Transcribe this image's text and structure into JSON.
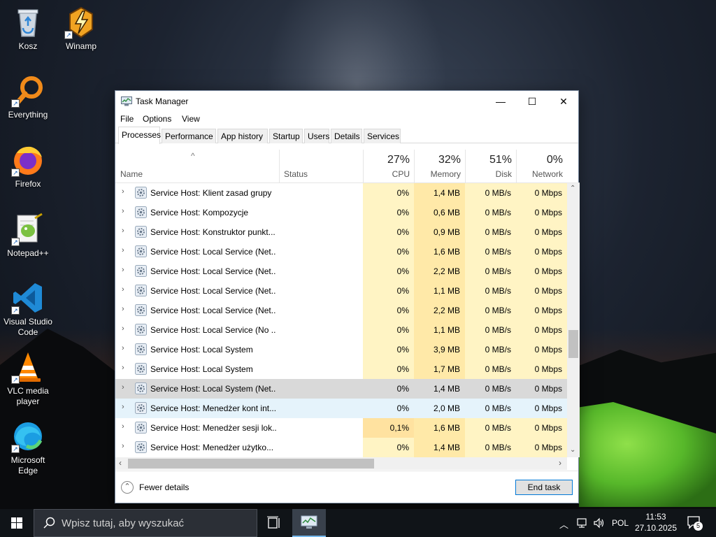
{
  "desktop": {
    "icons": [
      {
        "label": "Kosz",
        "icon": "recycle-bin-icon"
      },
      {
        "label": "Winamp",
        "icon": "winamp-icon"
      },
      {
        "label": "Everything",
        "icon": "everything-search-icon"
      },
      {
        "label": "Firefox",
        "icon": "firefox-icon"
      },
      {
        "label": "Notepad++",
        "icon": "notepadpp-icon"
      },
      {
        "label": "Visual Studio Code",
        "icon": "vscode-icon"
      },
      {
        "label": "VLC media player",
        "icon": "vlc-icon"
      },
      {
        "label": "Microsoft Edge",
        "icon": "edge-icon"
      }
    ]
  },
  "window": {
    "title": "Task Manager",
    "minimize": "—",
    "maximize": "☐",
    "close": "✕"
  },
  "menu": {
    "file": "File",
    "options": "Options",
    "view": "View"
  },
  "tabs": [
    {
      "label": "Processes",
      "active": true
    },
    {
      "label": "Performance"
    },
    {
      "label": "App history"
    },
    {
      "label": "Startup"
    },
    {
      "label": "Users"
    },
    {
      "label": "Details"
    },
    {
      "label": "Services"
    }
  ],
  "columns": {
    "sort_arrow": "^",
    "name": "Name",
    "status": "Status",
    "cpu": {
      "pct": "27%",
      "label": "CPU"
    },
    "memory": {
      "pct": "32%",
      "label": "Memory"
    },
    "disk": {
      "pct": "51%",
      "label": "Disk"
    },
    "network": {
      "pct": "0%",
      "label": "Network"
    }
  },
  "processes": [
    {
      "name": "Service Host: Klient zasad grupy",
      "cpu": "0%",
      "mem": "1,4 MB",
      "disk": "0 MB/s",
      "net": "0 Mbps"
    },
    {
      "name": "Service Host: Kompozycje",
      "cpu": "0%",
      "mem": "0,6 MB",
      "disk": "0 MB/s",
      "net": "0 Mbps"
    },
    {
      "name": "Service Host: Konstruktor punkt...",
      "cpu": "0%",
      "mem": "0,9 MB",
      "disk": "0 MB/s",
      "net": "0 Mbps"
    },
    {
      "name": "Service Host: Local Service (Net...",
      "cpu": "0%",
      "mem": "1,6 MB",
      "disk": "0 MB/s",
      "net": "0 Mbps"
    },
    {
      "name": "Service Host: Local Service (Net...",
      "cpu": "0%",
      "mem": "2,2 MB",
      "disk": "0 MB/s",
      "net": "0 Mbps"
    },
    {
      "name": "Service Host: Local Service (Net...",
      "cpu": "0%",
      "mem": "1,1 MB",
      "disk": "0 MB/s",
      "net": "0 Mbps"
    },
    {
      "name": "Service Host: Local Service (Net...",
      "cpu": "0%",
      "mem": "2,2 MB",
      "disk": "0 MB/s",
      "net": "0 Mbps"
    },
    {
      "name": "Service Host: Local Service (No ...",
      "cpu": "0%",
      "mem": "1,1 MB",
      "disk": "0 MB/s",
      "net": "0 Mbps"
    },
    {
      "name": "Service Host: Local System",
      "cpu": "0%",
      "mem": "3,9 MB",
      "disk": "0 MB/s",
      "net": "0 Mbps"
    },
    {
      "name": "Service Host: Local System",
      "cpu": "0%",
      "mem": "1,7 MB",
      "disk": "0 MB/s",
      "net": "0 Mbps"
    },
    {
      "name": "Service Host: Local System (Net...",
      "cpu": "0%",
      "mem": "1,4 MB",
      "disk": "0 MB/s",
      "net": "0 Mbps",
      "state": "selected"
    },
    {
      "name": "Service Host: Menedżer kont int...",
      "cpu": "0%",
      "mem": "2,0 MB",
      "disk": "0 MB/s",
      "net": "0 Mbps",
      "state": "hover"
    },
    {
      "name": "Service Host: Menedżer sesji lok...",
      "cpu": "0,1%",
      "mem": "1,6 MB",
      "disk": "0 MB/s",
      "net": "0 Mbps",
      "cpu_active": true
    },
    {
      "name": "Service Host: Menedżer użytko...",
      "cpu": "0%",
      "mem": "1,4 MB",
      "disk": "0 MB/s",
      "net": "0 Mbps"
    }
  ],
  "footer": {
    "fewer_details": "Fewer details",
    "end_task": "End task"
  },
  "colors": {
    "heat_light": "#fff4c4",
    "heat_medium": "#ffe9a8",
    "heat_active": "#ffe2a0",
    "selected_row": "#d9d9d9",
    "hover_row": "#e5f3fb",
    "accent": "#0078d7"
  },
  "taskbar": {
    "search_placeholder": "Wpisz tutaj, aby wyszukać",
    "language": "POL",
    "time": "11:53",
    "date": "27.10.2025",
    "notification_count": "5"
  }
}
